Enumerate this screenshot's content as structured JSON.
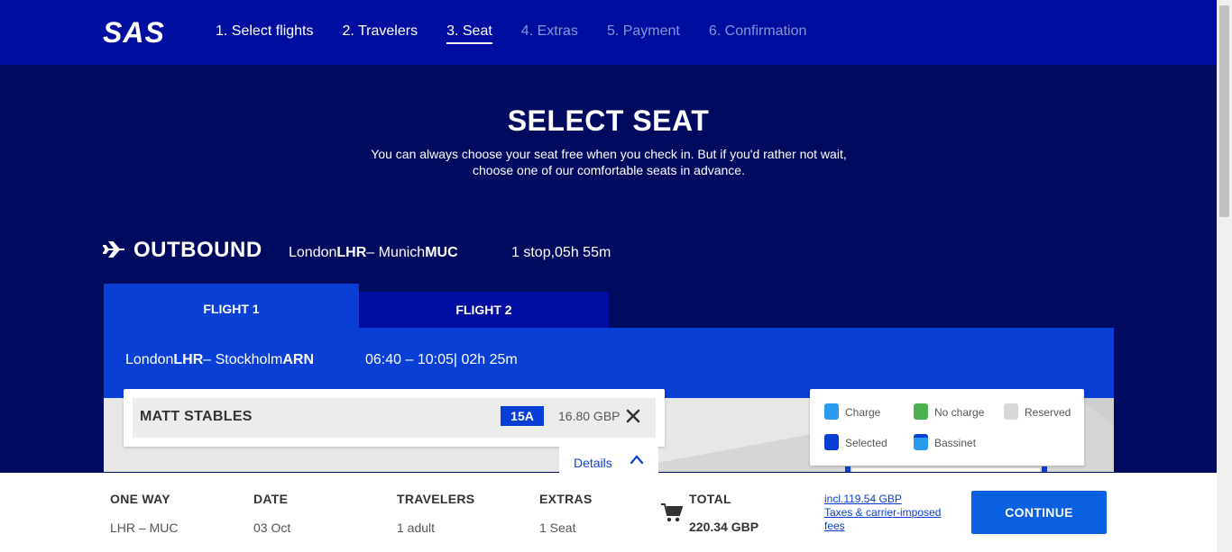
{
  "header": {
    "logo": "SAS",
    "steps": [
      {
        "label": "1. Select flights",
        "state": "done"
      },
      {
        "label": "2. Travelers",
        "state": "done"
      },
      {
        "label": "3. Seat",
        "state": "current"
      },
      {
        "label": "4. Extras",
        "state": "inactive"
      },
      {
        "label": "5. Payment",
        "state": "inactive"
      },
      {
        "label": "6. Confirmation",
        "state": "inactive"
      }
    ]
  },
  "main": {
    "title": "SELECT SEAT",
    "intro": "You can always choose your seat free when you check in. But if you'd rather not wait, choose one of our comfortable seats in advance."
  },
  "outbound": {
    "label": "OUTBOUND",
    "from_city": "London",
    "from_code": "LHR",
    "to_city": "Munich",
    "to_code": "MUC",
    "stops": "1 stop,05h 55m"
  },
  "tabs": [
    {
      "label": "FLIGHT 1",
      "active": true
    },
    {
      "label": "FLIGHT 2",
      "active": false
    }
  ],
  "flight": {
    "from_city": "London",
    "from_code": "LHR",
    "to_city": "Stockholm",
    "to_code": "ARN",
    "times": "06:40 – 10:05| 02h 25m"
  },
  "passenger": {
    "name": "MATT STABLES",
    "seat": "15A",
    "price": "16.80 GBP"
  },
  "details": {
    "label": "Details"
  },
  "legend": [
    {
      "label": "Charge",
      "color": "#2a9bf0"
    },
    {
      "label": "No charge",
      "color": "#4caf50"
    },
    {
      "label": "Reserved",
      "color": "#d8d8d8"
    },
    {
      "label": "Selected",
      "color": "#0a3fd6"
    },
    {
      "label": "Bassinet",
      "color": "#2a9bf0"
    }
  ],
  "footer": {
    "one_way_label": "ONE WAY",
    "one_way_value": "LHR – MUC",
    "date_label": "DATE",
    "date_value": "03 Oct",
    "travelers_label": "TRAVELERS",
    "travelers_value": "1 adult",
    "extras_label": "EXTRAS",
    "extras_value": "1 Seat",
    "total_label": "TOTAL",
    "total_value": "220.34 GBP",
    "fees_line1": "incl.119.54 GBP",
    "fees_line2": "Taxes & carrier-imposed fees",
    "continue": "CONTINUE"
  },
  "colors": {
    "header_bg": "#000ea0",
    "page_bg": "#000a5e",
    "accent": "#0a3fd6",
    "button": "#0a60e0"
  }
}
